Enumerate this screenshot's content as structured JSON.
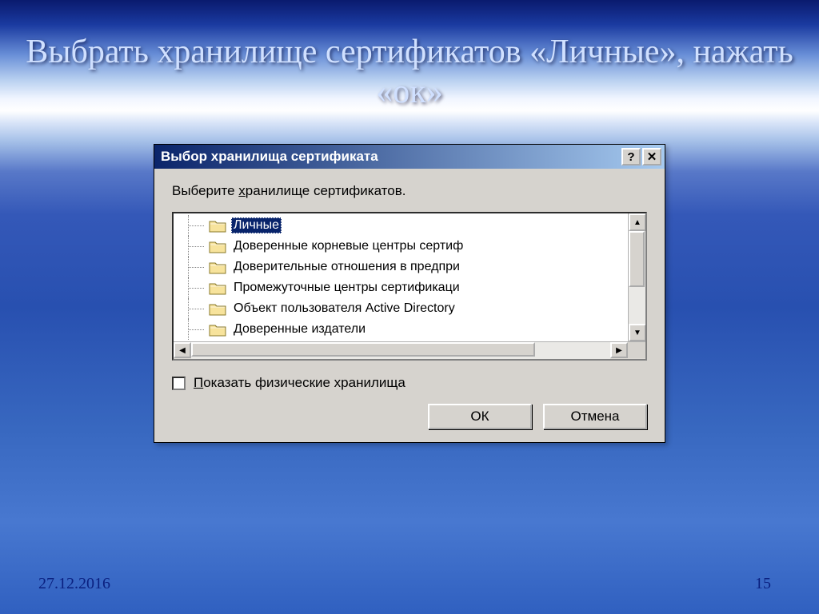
{
  "slide": {
    "title": "Выбрать хранилище сертификатов «Личные», нажать «ок»",
    "date": "27.12.2016",
    "page": "15"
  },
  "dialog": {
    "title": "Выбор хранилища сертификата",
    "instruction_prefix": "Выберите ",
    "instruction_underlined": "х",
    "instruction_suffix": "ранилище сертификатов.",
    "items": [
      {
        "label": "Личные",
        "selected": true
      },
      {
        "label": "Доверенные корневые центры сертиф",
        "selected": false
      },
      {
        "label": "Доверительные отношения в предпри",
        "selected": false
      },
      {
        "label": "Промежуточные центры сертификаци",
        "selected": false
      },
      {
        "label": "Объект пользователя Active Directory",
        "selected": false
      },
      {
        "label": "Доверенные издатели",
        "selected": false
      }
    ],
    "checkbox_underlined": "П",
    "checkbox_label": "оказать физические хранилища",
    "ok": "ОК",
    "cancel": "Отмена",
    "help_symbol": "?",
    "close_symbol": "✕"
  }
}
